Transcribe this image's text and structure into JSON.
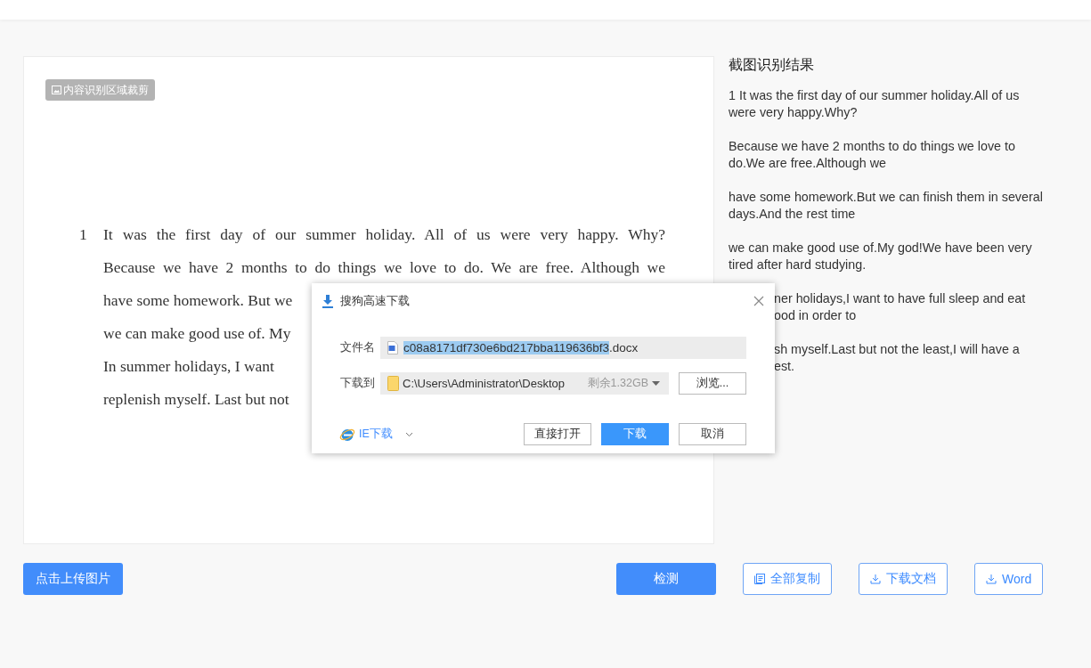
{
  "crop_badge": {
    "label": "内容识别区域裁剪"
  },
  "document": {
    "number": "1",
    "lines": [
      {
        "text": "It was the first day of our summer holiday. All of us were very happy. Why?",
        "kind": "full"
      },
      {
        "text": "Because we have 2 months to do things we love to do. We are free. Although we",
        "kind": "full"
      },
      {
        "text": "have some homework. But we",
        "kind": "cut"
      },
      {
        "text": "we can make good use of. My",
        "kind": "cut"
      },
      {
        "text": "In summer holidays, I want",
        "kind": "cut"
      },
      {
        "text": "replenish myself. Last but not",
        "kind": "cut"
      }
    ]
  },
  "result": {
    "title": "截图识别结果",
    "paragraphs": [
      {
        "kind": "whole",
        "lines": [
          "1 It was the first day of our summer holiday.All of us",
          "were very happy.Why?"
        ]
      },
      {
        "kind": "whole",
        "lines": [
          "Because we have 2 months to do things we love to",
          "do.We are free.Although we"
        ]
      },
      {
        "kind": "whole",
        "lines": [
          "have some homework.But we can finish them in several",
          "days.And the rest time"
        ]
      },
      {
        "kind": "whole",
        "lines": [
          "we can make good use of.My god!We have been very",
          "tired after hard studying."
        ]
      },
      {
        "kind": "covered",
        "lines": [
          "ner holidays,I want to have full sleep and eat",
          "ood in order to"
        ]
      },
      {
        "kind": "covered",
        "lines": [
          "sh myself.Last but not the least,I will have a",
          "est."
        ]
      }
    ]
  },
  "actions": {
    "upload": "点击上传图片",
    "buttons": [
      {
        "label": "检测",
        "kind": "primary"
      },
      {
        "label": "全部复制",
        "kind": "copy"
      },
      {
        "label": "下载文档",
        "kind": "download"
      },
      {
        "label": "Word",
        "kind": "download"
      }
    ]
  },
  "dialog": {
    "title": "搜狗高速下载",
    "file_label": "文件名",
    "file_name_selected": "c08a8171df730e6bd217bba119636bf3",
    "file_name_rest": ".docx",
    "path_label": "下载到",
    "path": "C:\\Users\\Administrator\\Desktop",
    "free_space": "剩余1.32GB",
    "browse": "浏览...",
    "ie_download": "IE下载",
    "buttons": [
      {
        "label": "直接打开",
        "kind": "default"
      },
      {
        "label": "下载",
        "kind": "primary"
      },
      {
        "label": "取消",
        "kind": "default"
      }
    ]
  }
}
